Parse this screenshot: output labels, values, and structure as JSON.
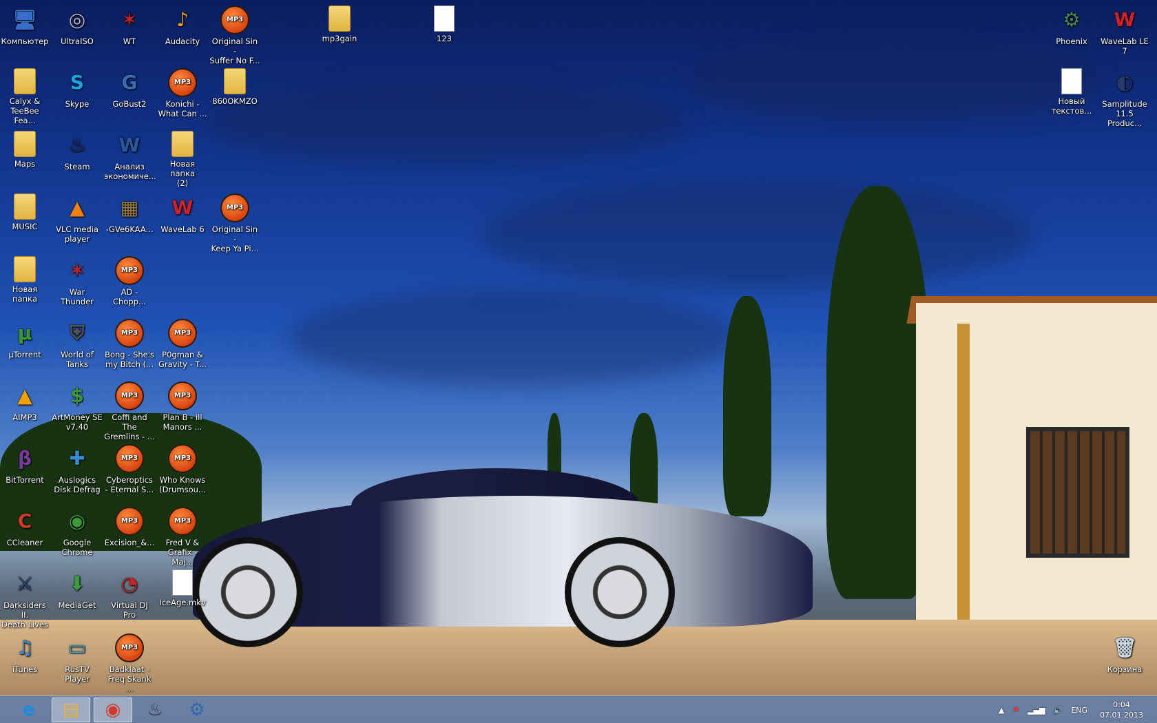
{
  "desktop": {
    "icons": [
      {
        "label": "Компьютер",
        "icon": "computer-icon",
        "kind": "generic",
        "color": "#3a6fc8",
        "glyph": "🖥"
      },
      {
        "label": "UltraISO",
        "icon": "disc-icon",
        "kind": "generic",
        "color": "#b7b7c8",
        "glyph": "◎"
      },
      {
        "label": "WT",
        "icon": "war-thunder-icon",
        "kind": "generic",
        "color": "#b22",
        "glyph": "✶"
      },
      {
        "label": "Audacity",
        "icon": "audacity-icon",
        "kind": "generic",
        "color": "#f0a020",
        "glyph": "♪"
      },
      {
        "label": "Original Sin -\nSuffer No F...",
        "icon": "mp3-icon",
        "kind": "mp3"
      },
      {
        "label": "mp3gain",
        "icon": "folder-icon",
        "kind": "folder"
      },
      {
        "label": "123",
        "icon": "document-icon",
        "kind": "doc"
      },
      {
        "label": "Phoenix",
        "icon": "phoenix-icon",
        "kind": "generic",
        "color": "#4a8a4a",
        "glyph": "⚙"
      },
      {
        "label": "WaveLab LE 7",
        "icon": "wavelab-icon",
        "kind": "generic",
        "color": "#d0202a",
        "glyph": "W"
      },
      {
        "label": "Calyx &\nTeeBee Fea...",
        "icon": "folder-music-icon",
        "kind": "folder"
      },
      {
        "label": "Skype",
        "icon": "skype-icon",
        "kind": "generic",
        "color": "#1ba4e3",
        "glyph": "S"
      },
      {
        "label": "GoBust2",
        "icon": "gobust-icon",
        "kind": "generic",
        "color": "#3a6ab0",
        "glyph": "G"
      },
      {
        "label": "Konichi -\nWhat Can ...",
        "icon": "mp3-icon",
        "kind": "mp3"
      },
      {
        "label": "860OKMZO",
        "icon": "folder-icon",
        "kind": "folder"
      },
      {
        "label": "Новый\nтекстов...",
        "icon": "text-document-icon",
        "kind": "doc"
      },
      {
        "label": "Samplitude\n11.5 Produc...",
        "icon": "samplitude-icon",
        "kind": "generic",
        "color": "#2a3a6a",
        "glyph": "◐"
      },
      {
        "label": "Maps",
        "icon": "folder-icon",
        "kind": "folder"
      },
      {
        "label": "Steam",
        "icon": "steam-icon",
        "kind": "generic",
        "color": "#2a2f38",
        "glyph": "♨"
      },
      {
        "label": "Анализ\nэкономиче...",
        "icon": "word-document-icon",
        "kind": "generic",
        "color": "#2b579a",
        "glyph": "W"
      },
      {
        "label": "Новая папка\n(2)",
        "icon": "folder-icon",
        "kind": "folder"
      },
      {
        "label": "MUSIC",
        "icon": "folder-music-icon",
        "kind": "folder"
      },
      {
        "label": "VLC media\nplayer",
        "icon": "vlc-icon",
        "kind": "generic",
        "color": "#f08010",
        "glyph": "▲"
      },
      {
        "label": "-GVe6KAA...",
        "icon": "image-icon",
        "kind": "generic",
        "color": "#a08040",
        "glyph": "▦"
      },
      {
        "label": "WaveLab 6",
        "icon": "wavelab-icon",
        "kind": "generic",
        "color": "#d0202a",
        "glyph": "W"
      },
      {
        "label": "Original Sin -\nKeep Ya Pi...",
        "icon": "mp3-icon",
        "kind": "mp3"
      },
      {
        "label": "Новая папка",
        "icon": "folder-icon",
        "kind": "folder"
      },
      {
        "label": "War Thunder",
        "icon": "war-thunder-icon",
        "kind": "generic",
        "color": "#b22",
        "glyph": "✶"
      },
      {
        "label": "AD -\nChopp...",
        "icon": "mp3-icon",
        "kind": "mp3"
      },
      {
        "label": "µTorrent",
        "icon": "utorrent-icon",
        "kind": "generic",
        "color": "#3a9a2a",
        "glyph": "µ"
      },
      {
        "label": "World of\nTanks",
        "icon": "world-of-tanks-icon",
        "kind": "generic",
        "color": "#555",
        "glyph": "⛨"
      },
      {
        "label": "Bong - She's\nmy Bitch (...",
        "icon": "mp3-icon",
        "kind": "mp3"
      },
      {
        "label": "P0gman &\nGravity - T...",
        "icon": "mp3-icon",
        "kind": "mp3"
      },
      {
        "label": "AIMP3",
        "icon": "aimp-icon",
        "kind": "generic",
        "color": "#f0a000",
        "glyph": "▲"
      },
      {
        "label": "ArtMoney SE\nv7.40",
        "icon": "artmoney-icon",
        "kind": "generic",
        "color": "#3a9a3a",
        "glyph": "$"
      },
      {
        "label": "Coffi and The\nGremlins - ...",
        "icon": "mp3-icon",
        "kind": "mp3"
      },
      {
        "label": "Plan B - ill\nManors ...",
        "icon": "mp3-icon",
        "kind": "mp3"
      },
      {
        "label": "BitTorrent",
        "icon": "bittorrent-icon",
        "kind": "generic",
        "color": "#7a3aa0",
        "glyph": "β"
      },
      {
        "label": "Auslogics\nDisk Defrag",
        "icon": "auslogics-icon",
        "kind": "generic",
        "color": "#3a8ad0",
        "glyph": "✚"
      },
      {
        "label": "Cyberoptics\n- Eternal S...",
        "icon": "mp3-icon",
        "kind": "mp3"
      },
      {
        "label": "Who Knows\n(Drumsou...",
        "icon": "mp3-icon",
        "kind": "mp3"
      },
      {
        "label": "CCleaner",
        "icon": "ccleaner-icon",
        "kind": "generic",
        "color": "#d03a2a",
        "glyph": "C"
      },
      {
        "label": "Google\nChrome",
        "icon": "chrome-icon",
        "kind": "generic",
        "color": "#3a9a3a",
        "glyph": "◉"
      },
      {
        "label": "Excision_&...",
        "icon": "mp3-icon",
        "kind": "mp3"
      },
      {
        "label": "Fred V &\nGrafix - Maj...",
        "icon": "mp3-icon",
        "kind": "mp3"
      },
      {
        "label": "Darksiders II.\nDeath Lives",
        "icon": "darksiders-icon",
        "kind": "generic",
        "color": "#2a4a7a",
        "glyph": "⚔"
      },
      {
        "label": "MediaGet",
        "icon": "mediaget-icon",
        "kind": "generic",
        "color": "#3a9a3a",
        "glyph": "⬇"
      },
      {
        "label": "Virtual DJ Pro",
        "icon": "virtualdj-icon",
        "kind": "generic",
        "color": "#d02020",
        "glyph": "◔"
      },
      {
        "label": "IceAge.mkv",
        "icon": "document-icon",
        "kind": "doc"
      },
      {
        "label": "iTunes",
        "icon": "itunes-icon",
        "kind": "generic",
        "color": "#3a8ae0",
        "glyph": "♫"
      },
      {
        "label": "RusTV Player",
        "icon": "rustv-icon",
        "kind": "generic",
        "color": "#3aa0d0",
        "glyph": "▭"
      },
      {
        "label": "Badklaat -\nFreq Skank ...",
        "icon": "mp3-icon",
        "kind": "mp3"
      },
      {
        "label": "Корзина",
        "icon": "recycle-bin-icon",
        "kind": "generic",
        "color": "#c8d4e0",
        "glyph": "🗑"
      }
    ],
    "mp3_badge": "MP3"
  },
  "taskbar": {
    "apps": [
      {
        "name": "internet-explorer-taskbar-button",
        "icon": "internet-explorer-icon",
        "glyph": "e",
        "color": "#1a8ae0",
        "active": false
      },
      {
        "name": "file-explorer-taskbar-button",
        "icon": "folder-icon",
        "glyph": "▤",
        "color": "#e2b441",
        "active": true
      },
      {
        "name": "chrome-taskbar-button",
        "icon": "chrome-icon",
        "glyph": "◉",
        "color": "#d03a2a",
        "active": true
      },
      {
        "name": "steam-taskbar-button",
        "icon": "steam-icon",
        "glyph": "♨",
        "color": "#2a2f38",
        "active": false
      },
      {
        "name": "app-taskbar-button",
        "icon": "gear-icon",
        "glyph": "⚙",
        "color": "#2a6ab0",
        "active": false
      }
    ],
    "tray": {
      "language": "ENG",
      "time": "0:04",
      "date": "07.01.2013"
    }
  }
}
